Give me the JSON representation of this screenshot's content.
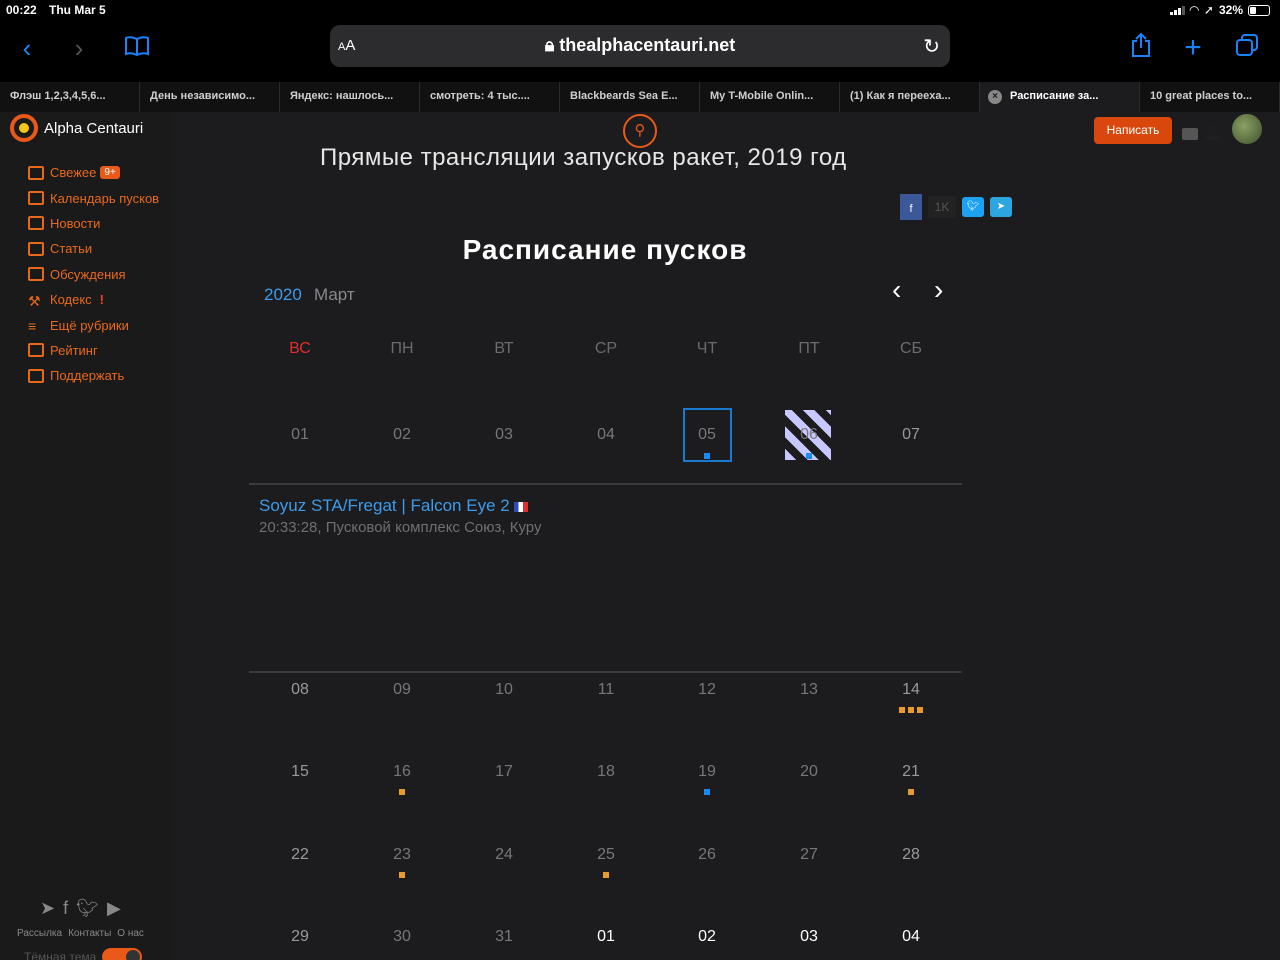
{
  "status_bar": {
    "time": "00:22",
    "date": "Thu Mar 5",
    "battery": "32%",
    "battery_level": 0.32
  },
  "browser": {
    "aa_label": "AA",
    "url": "thealphacentauri.net",
    "tabs": [
      {
        "label": "Флэш 1,2,3,4,5,6..."
      },
      {
        "label": "День независимо..."
      },
      {
        "label": "Яндекс: нашлось..."
      },
      {
        "label": "смотреть: 4 тыс...."
      },
      {
        "label": "Blackbeards Sea E..."
      },
      {
        "label": "My T-Mobile Onlin..."
      },
      {
        "label": "(1) Как я переexa..."
      },
      {
        "label": "Расписание за..."
      },
      {
        "label": "10 great places to..."
      }
    ],
    "close_glyph": "×"
  },
  "site": {
    "brand": "Alpha Centauri",
    "write_button": "Написать",
    "headline": "Прямые трансляции запусков ракет, 2019 год",
    "share_count": "1K",
    "nav": [
      {
        "label": "Свежее",
        "badge": "9+"
      },
      {
        "label": "Календарь пусков"
      },
      {
        "label": "Новости"
      },
      {
        "label": "Статьи"
      },
      {
        "label": "Обсуждения"
      },
      {
        "label": "Кодекс",
        "mark": "!"
      },
      {
        "label": "Ещё рубрики"
      },
      {
        "label": "Рейтинг"
      },
      {
        "label": "Поддержать"
      }
    ],
    "footer_links": [
      "Рассылка",
      "Контакты",
      "О нас"
    ],
    "theme_label": "Тёмная тема",
    "colors": {
      "accent": "#e8591a",
      "link": "#3d9be9",
      "launch_orange": "#e89a2c",
      "launch_blue": "#1a8bf0"
    }
  },
  "calendar": {
    "title": "Расписание пусков",
    "year": "2020",
    "month": "Март",
    "weekdays": [
      "ВС",
      "ПН",
      "ВТ",
      "СР",
      "ЧТ",
      "ПТ",
      "СБ"
    ],
    "weeks": [
      [
        "01",
        "02",
        "03",
        "04",
        "05",
        "06",
        "07"
      ],
      [
        "08",
        "09",
        "10",
        "11",
        "12",
        "13",
        "14"
      ],
      [
        "15",
        "16",
        "17",
        "18",
        "19",
        "20",
        "21"
      ],
      [
        "22",
        "23",
        "24",
        "25",
        "26",
        "27",
        "28"
      ],
      [
        "29",
        "30",
        "31",
        "01",
        "02",
        "03",
        "04"
      ]
    ],
    "selected_day": "05",
    "event": {
      "title": "Soyuz STA/Fregat | Falcon Eye 2",
      "details": "20:33:28, Пусковой комплекс Союз, Куру"
    }
  }
}
